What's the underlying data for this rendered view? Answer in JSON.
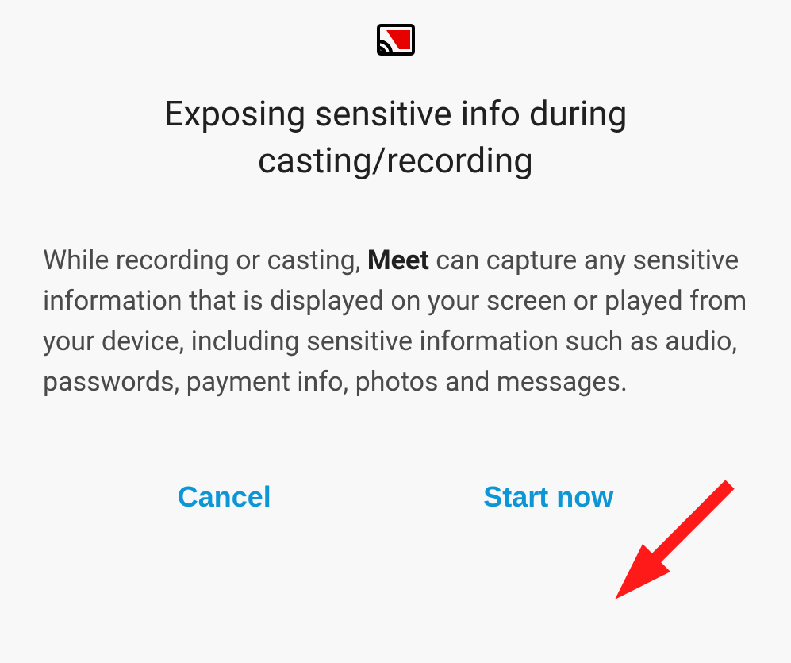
{
  "dialog": {
    "title": "Exposing sensitive info during casting/recording",
    "body_before": "While recording or casting, ",
    "body_bold": "Meet",
    "body_after": " can capture any sensitive information that is displayed on your screen or played from your device, including sensitive information such as audio, passwords, payment info, photos and messages.",
    "cancel_label": "Cancel",
    "start_label": "Start now"
  },
  "colors": {
    "accent": "#0d96d6",
    "icon_red": "#e60000"
  }
}
